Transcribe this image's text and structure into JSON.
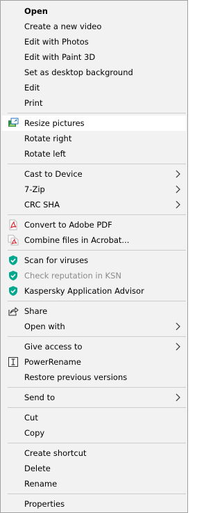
{
  "menu": {
    "open": "Open",
    "create_video": "Create a new video",
    "edit_photos": "Edit with Photos",
    "edit_paint3d": "Edit with Paint 3D",
    "set_desktop_bg": "Set as desktop background",
    "edit": "Edit",
    "print": "Print",
    "resize_pictures": "Resize pictures",
    "rotate_right": "Rotate right",
    "rotate_left": "Rotate left",
    "cast_to_device": "Cast to Device",
    "seven_zip": "7-Zip",
    "crc_sha": "CRC SHA",
    "convert_pdf": "Convert to Adobe PDF",
    "combine_acrobat": "Combine files in Acrobat...",
    "scan_viruses": "Scan for viruses",
    "check_reputation": "Check reputation in KSN",
    "kaspersky_advisor": "Kaspersky Application Advisor",
    "share": "Share",
    "open_with": "Open with",
    "give_access": "Give access to",
    "power_rename": "PowerRename",
    "restore_versions": "Restore previous versions",
    "send_to": "Send to",
    "cut": "Cut",
    "copy": "Copy",
    "create_shortcut": "Create shortcut",
    "delete": "Delete",
    "rename": "Rename",
    "properties": "Properties"
  },
  "icons": {
    "resize": "resize-pictures-icon",
    "pdf": "adobe-pdf-icon",
    "combine": "acrobat-combine-icon",
    "kaspersky": "kaspersky-shield-icon",
    "share": "share-icon",
    "power_rename": "power-rename-icon",
    "submenu": "chevron-right-icon"
  },
  "colors": {
    "menu_background": "#f2f2f2",
    "hover_background": "#ffffff",
    "separator": "#cccccc",
    "disabled_text": "#8a8a8a",
    "kaspersky_green": "#00a88e",
    "pdf_red": "#d8232a"
  },
  "state": {
    "highlighted_item": "Resize pictures",
    "disabled_items": [
      "Check reputation in KSN"
    ]
  }
}
